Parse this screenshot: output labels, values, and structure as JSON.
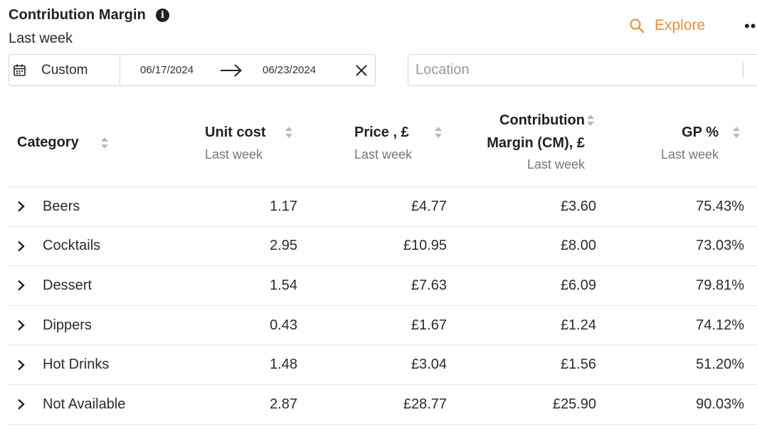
{
  "header": {
    "title": "Contribution Margin",
    "subtitle": "Last week",
    "explore_label": "Explore",
    "more_label": "••"
  },
  "date_filter": {
    "mode": "Custom",
    "from": "06/17/2024",
    "to": "06/23/2024"
  },
  "location_filter": {
    "placeholder": "Location"
  },
  "table": {
    "columns": [
      {
        "label": "Category",
        "sub": ""
      },
      {
        "label": "Unit cost",
        "sub": "Last week"
      },
      {
        "label": "Price , £",
        "sub": "Last week"
      },
      {
        "label_line1": "Contribution",
        "label_line2": "Margin (CM), £",
        "sub": "Last week"
      },
      {
        "label": "GP %",
        "sub": "Last week"
      }
    ],
    "rows": [
      {
        "category": "Beers",
        "unit_cost": "1.17",
        "price": "£4.77",
        "cm": "£3.60",
        "gp": "75.43%"
      },
      {
        "category": "Cocktails",
        "unit_cost": "2.95",
        "price": "£10.95",
        "cm": "£8.00",
        "gp": "73.03%"
      },
      {
        "category": "Dessert",
        "unit_cost": "1.54",
        "price": "£7.63",
        "cm": "£6.09",
        "gp": "79.81%"
      },
      {
        "category": "Dippers",
        "unit_cost": "0.43",
        "price": "£1.67",
        "cm": "£1.24",
        "gp": "74.12%"
      },
      {
        "category": "Hot Drinks",
        "unit_cost": "1.48",
        "price": "£3.04",
        "cm": "£1.56",
        "gp": "51.20%"
      },
      {
        "category": "Not Available",
        "unit_cost": "2.87",
        "price": "£28.77",
        "cm": "£25.90",
        "gp": "90.03%"
      }
    ]
  },
  "colors": {
    "accent": "#ef8a3a",
    "text": "#222222",
    "muted": "#777777",
    "border": "#d6d6d6"
  }
}
